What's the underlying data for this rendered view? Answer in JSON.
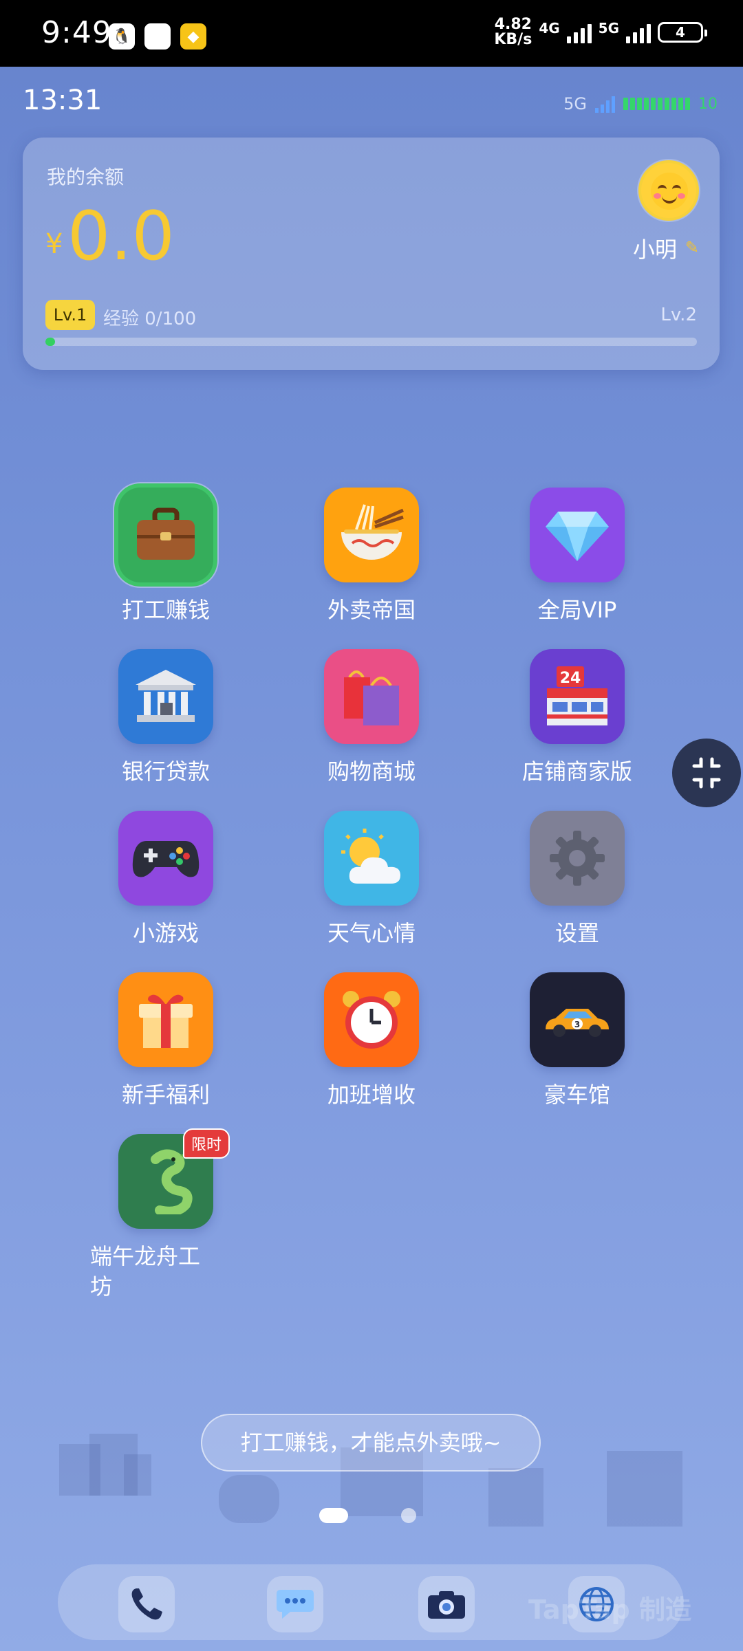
{
  "system_bar": {
    "time": "9:49",
    "net_speed_value": "4.82",
    "net_speed_unit": "KB/s",
    "net1": "4G",
    "net2": "5G",
    "battery": "4"
  },
  "game_status": {
    "time": "13:31",
    "network": "5G",
    "battery_level": "10"
  },
  "balance_card": {
    "label": "我的余额",
    "currency": "¥",
    "amount": "0.0",
    "username": "小明",
    "level": "Lv.1",
    "exp_text": "经验 0/100",
    "next_level": "Lv.2",
    "progress_fraction": 0.0
  },
  "apps": [
    {
      "label": "打工赚钱",
      "icon": "briefcase-icon",
      "color": "#35ad5b"
    },
    {
      "label": "外卖帝国",
      "icon": "noodle-bowl-icon",
      "color": "#ffa20f"
    },
    {
      "label": "全局VIP",
      "icon": "diamond-icon",
      "color": "#8b4ce8"
    },
    {
      "label": "银行贷款",
      "icon": "bank-icon",
      "color": "#2f7ad6"
    },
    {
      "label": "购物商城",
      "icon": "shopping-bags-icon",
      "color": "#ea4f86"
    },
    {
      "label": "店铺商家版",
      "icon": "store-24-icon",
      "color": "#6a3fd0"
    },
    {
      "label": "小游戏",
      "icon": "gamepad-icon",
      "color": "#8f48df"
    },
    {
      "label": "天气心情",
      "icon": "sun-cloud-icon",
      "color": "#40b6e6"
    },
    {
      "label": "设置",
      "icon": "gear-icon",
      "color": "#7f8096"
    },
    {
      "label": "新手福利",
      "icon": "gift-icon",
      "color": "#ff8f14"
    },
    {
      "label": "加班增收",
      "icon": "alarm-clock-icon",
      "color": "#ff6a14"
    },
    {
      "label": "豪车馆",
      "icon": "race-car-icon",
      "color": "#1e2034"
    },
    {
      "label": "端午龙舟工坊",
      "icon": "dragon-icon",
      "color": "#2f7d4e",
      "tag": "限时"
    }
  ],
  "toast": "打工赚钱，才能点外卖哦~",
  "pager": {
    "current": 1,
    "total": 2
  },
  "dock": [
    {
      "icon": "phone-icon"
    },
    {
      "icon": "message-icon"
    },
    {
      "icon": "camera-icon"
    },
    {
      "icon": "globe-icon"
    }
  ],
  "watermark": "TapTap 制造"
}
